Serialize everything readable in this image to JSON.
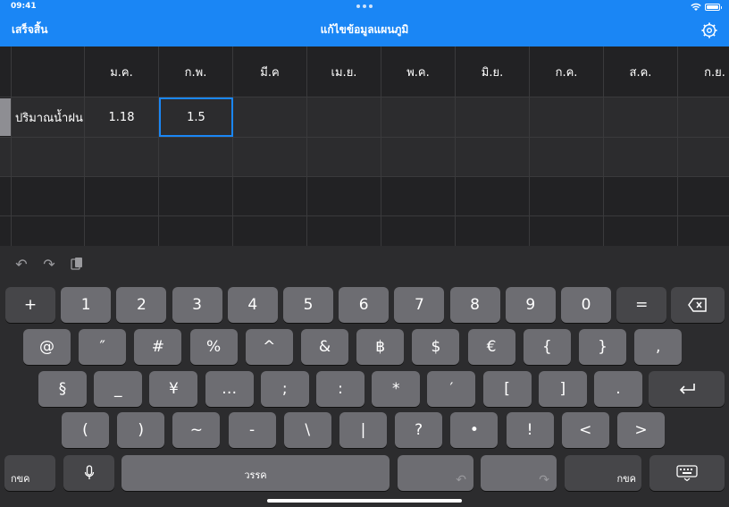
{
  "status": {
    "time": "09:41"
  },
  "nav": {
    "done": "เสร็จสิ้น",
    "title": "แก้ไขข้อมูลแผนภูมิ"
  },
  "table": {
    "months": [
      "ม.ค.",
      "ก.พ.",
      "มี.ค",
      "เม.ย.",
      "พ.ค.",
      "มิ.ย.",
      "ก.ค.",
      "ส.ค.",
      "ก.ย."
    ],
    "row_label": "ปริมาณน้ำฝน",
    "values": [
      "1.18",
      "1.5"
    ],
    "selected_cell": "1.5"
  },
  "keyboard": {
    "row1": [
      "+",
      "1",
      "2",
      "3",
      "4",
      "5",
      "6",
      "7",
      "8",
      "9",
      "0",
      "="
    ],
    "row2": [
      "@",
      "″",
      "#",
      "%",
      "^",
      "&",
      "฿",
      "$",
      "€",
      "{",
      "}",
      ","
    ],
    "row3": [
      "§",
      "_",
      "¥",
      "…",
      ";",
      ":",
      "*",
      "′",
      "[",
      "]",
      "."
    ],
    "row4": [
      "(",
      ")",
      "~",
      "-",
      "\\",
      "|",
      "?",
      "•",
      "!",
      "<",
      ">"
    ],
    "lang_key": "กขค",
    "space_label": "วรรค",
    "lang_key_right": "กขค"
  }
}
